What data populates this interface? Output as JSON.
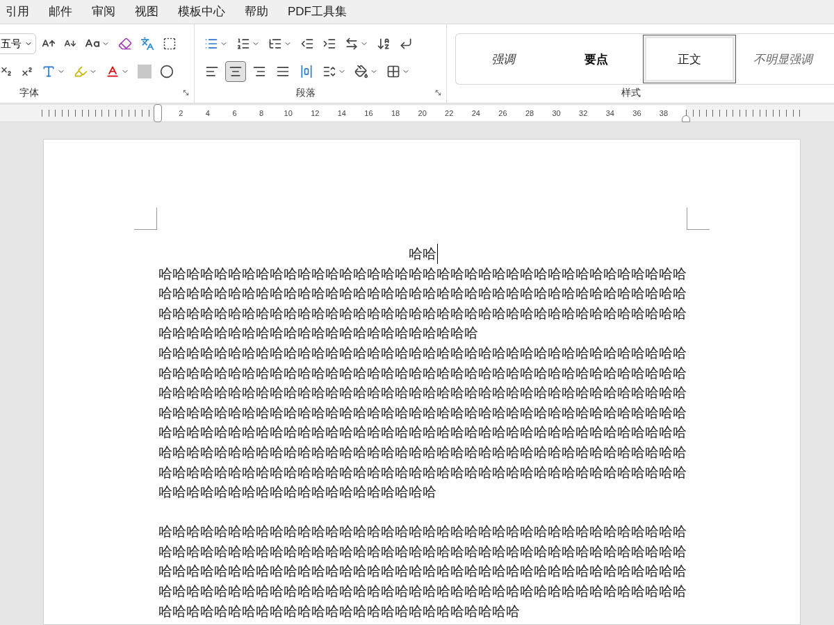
{
  "menu_tabs": [
    {
      "label": "引用"
    },
    {
      "label": "邮件"
    },
    {
      "label": "审阅"
    },
    {
      "label": "视图"
    },
    {
      "label": "模板中心"
    },
    {
      "label": "帮助"
    },
    {
      "label": "PDF工具集"
    }
  ],
  "font_group": {
    "title": "字体",
    "font_size": "五号"
  },
  "paragraph_group": {
    "title": "段落",
    "alignments": [
      {
        "kind": "left",
        "selected": false
      },
      {
        "kind": "center",
        "selected": true
      },
      {
        "kind": "right",
        "selected": false
      },
      {
        "kind": "justify",
        "selected": false
      },
      {
        "kind": "distributed",
        "selected": false
      }
    ]
  },
  "styles_group": {
    "title": "样式",
    "styles": [
      {
        "label": "强调",
        "kind": "emphasis",
        "selected": false
      },
      {
        "label": "要点",
        "kind": "strong",
        "selected": false
      },
      {
        "label": "正文",
        "kind": "normal",
        "selected": true
      },
      {
        "label": "不明显强调",
        "kind": "subtle",
        "selected": false
      }
    ]
  },
  "ruler": {
    "labels": [
      "2",
      "4",
      "6",
      "8",
      "10",
      "12",
      "14",
      "16",
      "18",
      "20",
      "22",
      "24",
      "26",
      "28",
      "30",
      "32",
      "34",
      "36",
      "38"
    ]
  },
  "document": {
    "header_line": "哈哈",
    "paragraphs": [
      {
        "text": "哈哈哈哈哈哈哈哈哈哈哈哈哈哈哈哈哈哈哈哈哈哈哈哈哈哈哈哈哈哈哈哈哈哈哈哈哈哈哈哈哈哈哈哈哈哈哈哈哈哈哈哈哈哈哈哈哈哈哈哈哈哈哈哈哈哈哈哈哈哈哈哈哈哈哈哈哈哈哈哈哈哈哈哈哈哈哈哈哈哈哈哈哈哈哈哈哈哈哈哈哈哈哈哈哈哈哈哈哈哈哈哈哈哈哈哈哈哈哈哈哈哈哈哈哈哈哈哈哈哈哈哈哈哈哈哈哈",
        "space_before": false
      },
      {
        "text": "哈哈哈哈哈哈哈哈哈哈哈哈哈哈哈哈哈哈哈哈哈哈哈哈哈哈哈哈哈哈哈哈哈哈哈哈哈哈哈哈哈哈哈哈哈哈哈哈哈哈哈哈哈哈哈哈哈哈哈哈哈哈哈哈哈哈哈哈哈哈哈哈哈哈哈哈哈哈哈哈哈哈哈哈哈哈哈哈哈哈哈哈哈哈哈哈哈哈哈哈哈哈哈哈哈哈哈哈哈哈哈哈哈哈哈哈哈哈哈哈哈哈哈哈哈哈哈哈哈哈哈哈哈哈哈哈哈哈哈哈哈哈哈哈哈哈哈哈哈哈哈哈哈哈哈哈哈哈哈哈哈哈哈哈哈哈哈哈哈哈哈哈哈哈哈哈哈哈哈哈哈哈哈哈哈哈哈哈哈哈哈哈哈哈哈哈哈哈哈哈哈哈哈哈哈哈哈哈哈哈哈哈哈哈哈哈哈哈哈哈哈哈哈哈哈哈哈哈哈哈哈哈哈哈哈哈哈哈哈哈哈哈哈哈哈哈哈哈哈哈哈哈哈哈哈哈哈哈哈哈哈哈哈哈哈哈哈哈哈哈哈哈哈哈哈哈哈哈哈哈哈哈哈哈哈哈",
        "space_before": false
      },
      {
        "text": "哈哈哈哈哈哈哈哈哈哈哈哈哈哈哈哈哈哈哈哈哈哈哈哈哈哈哈哈哈哈哈哈哈哈哈哈哈哈哈哈哈哈哈哈哈哈哈哈哈哈哈哈哈哈哈哈哈哈哈哈哈哈哈哈哈哈哈哈哈哈哈哈哈哈哈哈哈哈哈哈哈哈哈哈哈哈哈哈哈哈哈哈哈哈哈哈哈哈哈哈哈哈哈哈哈哈哈哈哈哈哈哈哈哈哈哈哈哈哈哈哈哈哈哈哈哈哈哈哈哈哈哈哈哈哈哈哈哈哈哈哈哈哈哈哈哈哈哈哈哈哈哈哈哈哈哈哈哈哈哈哈哈哈哈哈哈哈哈哈哈哈哈哈哈哈哈哈哈",
        "space_before": true
      }
    ]
  }
}
